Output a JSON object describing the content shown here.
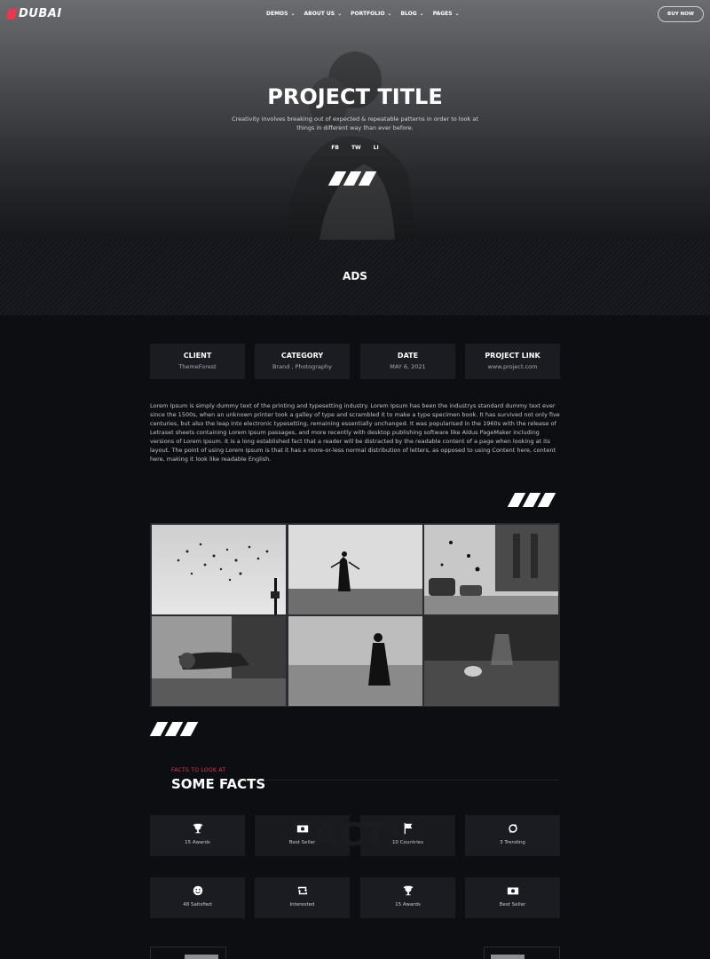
{
  "nav": {
    "logo": "DUBAI",
    "menu": [
      "DEMOS",
      "ABOUT US",
      "PORTFOLIO",
      "BLOG",
      "PAGES"
    ],
    "buy_label": "BUY NOW"
  },
  "hero": {
    "title": "PROJECT TITLE",
    "subtitle": "Creativity involves breaking out of expected & repeatable patterns in order to look at things in different way than ever before.",
    "socials": [
      "FB",
      "TW",
      "LI"
    ]
  },
  "band": {
    "title": "ADS"
  },
  "info": [
    {
      "label": "CLIENT",
      "value": "ThemeForest"
    },
    {
      "label": "CATEGORY",
      "value": "Brand , Photography"
    },
    {
      "label": "DATE",
      "value": "MAY 6, 2021"
    },
    {
      "label": "PROJECT LINK",
      "value": "www.project.com"
    }
  ],
  "body_text": "Lorem Ipsum is simply dummy text of the printing and typesetting industry. Lorem Ipsum has been the industrys standard dummy text ever since the 1500s, when an unknown printer took a galley of type and scrambled it to make a type specimen book. It has survived not only five centuries, but also the leap into electronic typesetting, remaining essentially unchanged. It was popularised in the 1960s with the release of Letraset sheets containing Lorem Ipsum passages, and more recently with desktop publishing software like Aldus PageMaker including versions of Lorem Ipsum. It is a long established fact that a reader will be distracted by the readable content of a page when looking at its layout. The point of using Lorem Ipsum is that it has a more-or-less normal distribution of letters, as opposed to using Content here, content here, making it look like readable English.",
  "facts": {
    "eyebrow": "FACTS TO LOOK AT",
    "title": "SOME FACTS",
    "watermark": "FACTS",
    "items": [
      {
        "icon": "trophy-icon",
        "label": "15 Awards"
      },
      {
        "icon": "money-icon",
        "label": "Best Seller"
      },
      {
        "icon": "flag-icon",
        "label": "10 Countries"
      },
      {
        "icon": "refresh-icon",
        "label": "3 Trending"
      },
      {
        "icon": "smile-icon",
        "label": "48 Satisfied"
      },
      {
        "icon": "retweet-icon",
        "label": "Interested"
      },
      {
        "icon": "trophy-icon",
        "label": "15 Awards"
      },
      {
        "icon": "money-icon",
        "label": "Best Seller"
      }
    ]
  },
  "colors": {
    "accent": "#e8374f",
    "background": "#0d0e12",
    "card": "#1b1c21"
  }
}
